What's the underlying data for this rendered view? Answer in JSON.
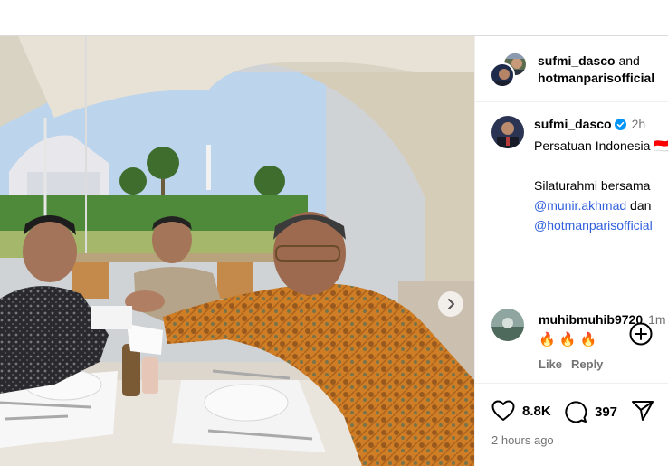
{
  "post": {
    "header": {
      "user1": "sufmi_dasco",
      "joiner": "and",
      "user2": "hotmanparisofficial"
    },
    "caption": {
      "username": "sufmi_dasco",
      "time": "2h",
      "line1": "Persatuan Indonesia 🇮🇩",
      "line2": "Silaturahmi bersama",
      "mention1": "@munir.akhmad",
      "and_word": "dan",
      "mention2": "@hotmanparisofficial"
    },
    "comment": {
      "username": "muhibmuhib9720",
      "time": "1m",
      "text": "🔥 🔥 🔥",
      "like_label": "Like",
      "reply_label": "Reply"
    },
    "stats": {
      "likes": "8.8K",
      "comments": "397",
      "posted": "2 hours ago"
    }
  },
  "colors": {
    "mention": "#2f5fdc",
    "verified": "#0095f6",
    "muted": "#737373"
  },
  "icons": [
    "chevron-right-icon",
    "verified-badge-icon",
    "add-circle-icon",
    "heart-icon",
    "comment-icon",
    "share-icon"
  ]
}
